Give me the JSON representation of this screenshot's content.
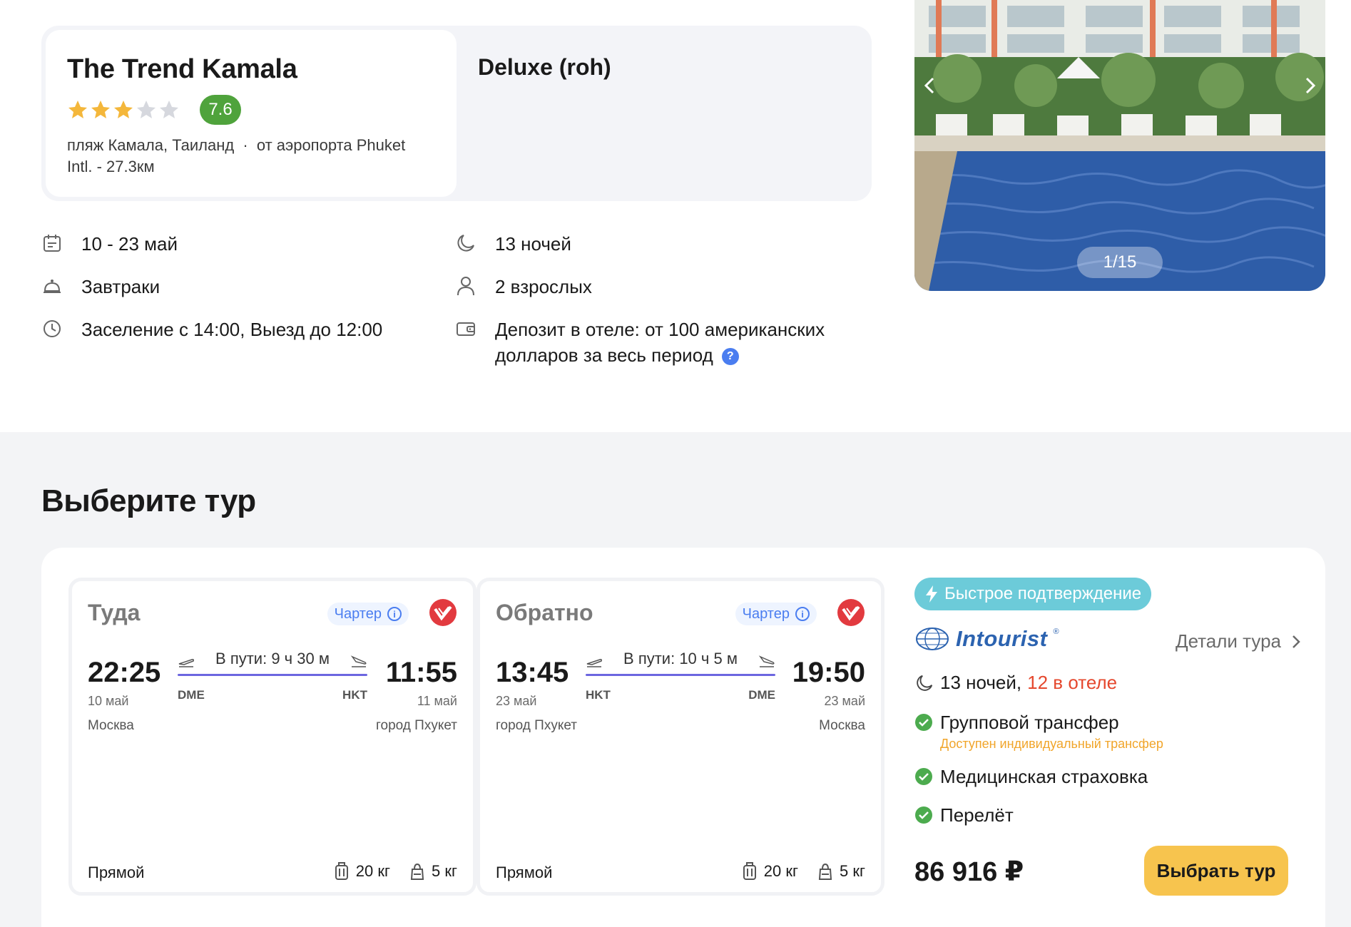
{
  "hotel": {
    "name": "The Trend Kamala",
    "stars_filled": 3,
    "stars_total": 5,
    "score": "7.6",
    "location": "пляж Камала, Таиланд",
    "airport": "от аэропорта Phuket Intl. - 27.3км",
    "separator": "·",
    "room": "Deluxe (roh)"
  },
  "details": {
    "dates": "10 - 23 май",
    "meal": "Завтраки",
    "checkin": "Заселение с 14:00, Выезд до 12:00",
    "nights": "13 ночей",
    "guests": "2 взрослых",
    "deposit": "Депозит в отеле: от 100 американских долларов за весь период",
    "help": "?"
  },
  "gallery": {
    "counter": "1/15"
  },
  "tours": {
    "title": "Выберите тур",
    "outbound": {
      "direction": "Туда",
      "badge": "Чартер",
      "dep_time": "22:25",
      "dep_date": "10 май",
      "arr_time": "11:55",
      "arr_date": "11 май",
      "duration": "В пути: 9 ч 30 м",
      "dep_code": "DME",
      "arr_code": "HKT",
      "dep_city": "Москва",
      "arr_city": "город Пхукет",
      "type": "Прямой",
      "baggage": "20 кг",
      "hand_luggage": "5 кг"
    },
    "return": {
      "direction": "Обратно",
      "badge": "Чартер",
      "dep_time": "13:45",
      "dep_date": "23 май",
      "arr_time": "19:50",
      "arr_date": "23 май",
      "duration": "В пути: 10 ч 5 м",
      "dep_code": "HKT",
      "arr_code": "DME",
      "dep_city": "город Пхукет",
      "arr_city": "Москва",
      "type": "Прямой",
      "baggage": "20 кг",
      "hand_luggage": "5 кг"
    },
    "offer": {
      "fast_badge": "Быстрое подтверждение",
      "operator": "Intourist",
      "operator_reg": "®",
      "details_link": "Детали тура",
      "nights": "13 ночей,",
      "nights_hotel": "12 в отеле",
      "services": [
        {
          "label": "Групповой трансфер",
          "note": "Доступен индивидуальный трансфер"
        },
        {
          "label": "Медицинская страховка"
        },
        {
          "label": "Перелёт"
        }
      ],
      "price": "86 916 ₽",
      "button": "Выбрать тур"
    }
  },
  "colors": {
    "score_bg": "#4fa33c",
    "accent_red": "#e5482e",
    "button": "#f7c44e",
    "fast_badge": "#6ccbd9",
    "route_line": "#6c66e0",
    "operator": "#2c63b0"
  }
}
